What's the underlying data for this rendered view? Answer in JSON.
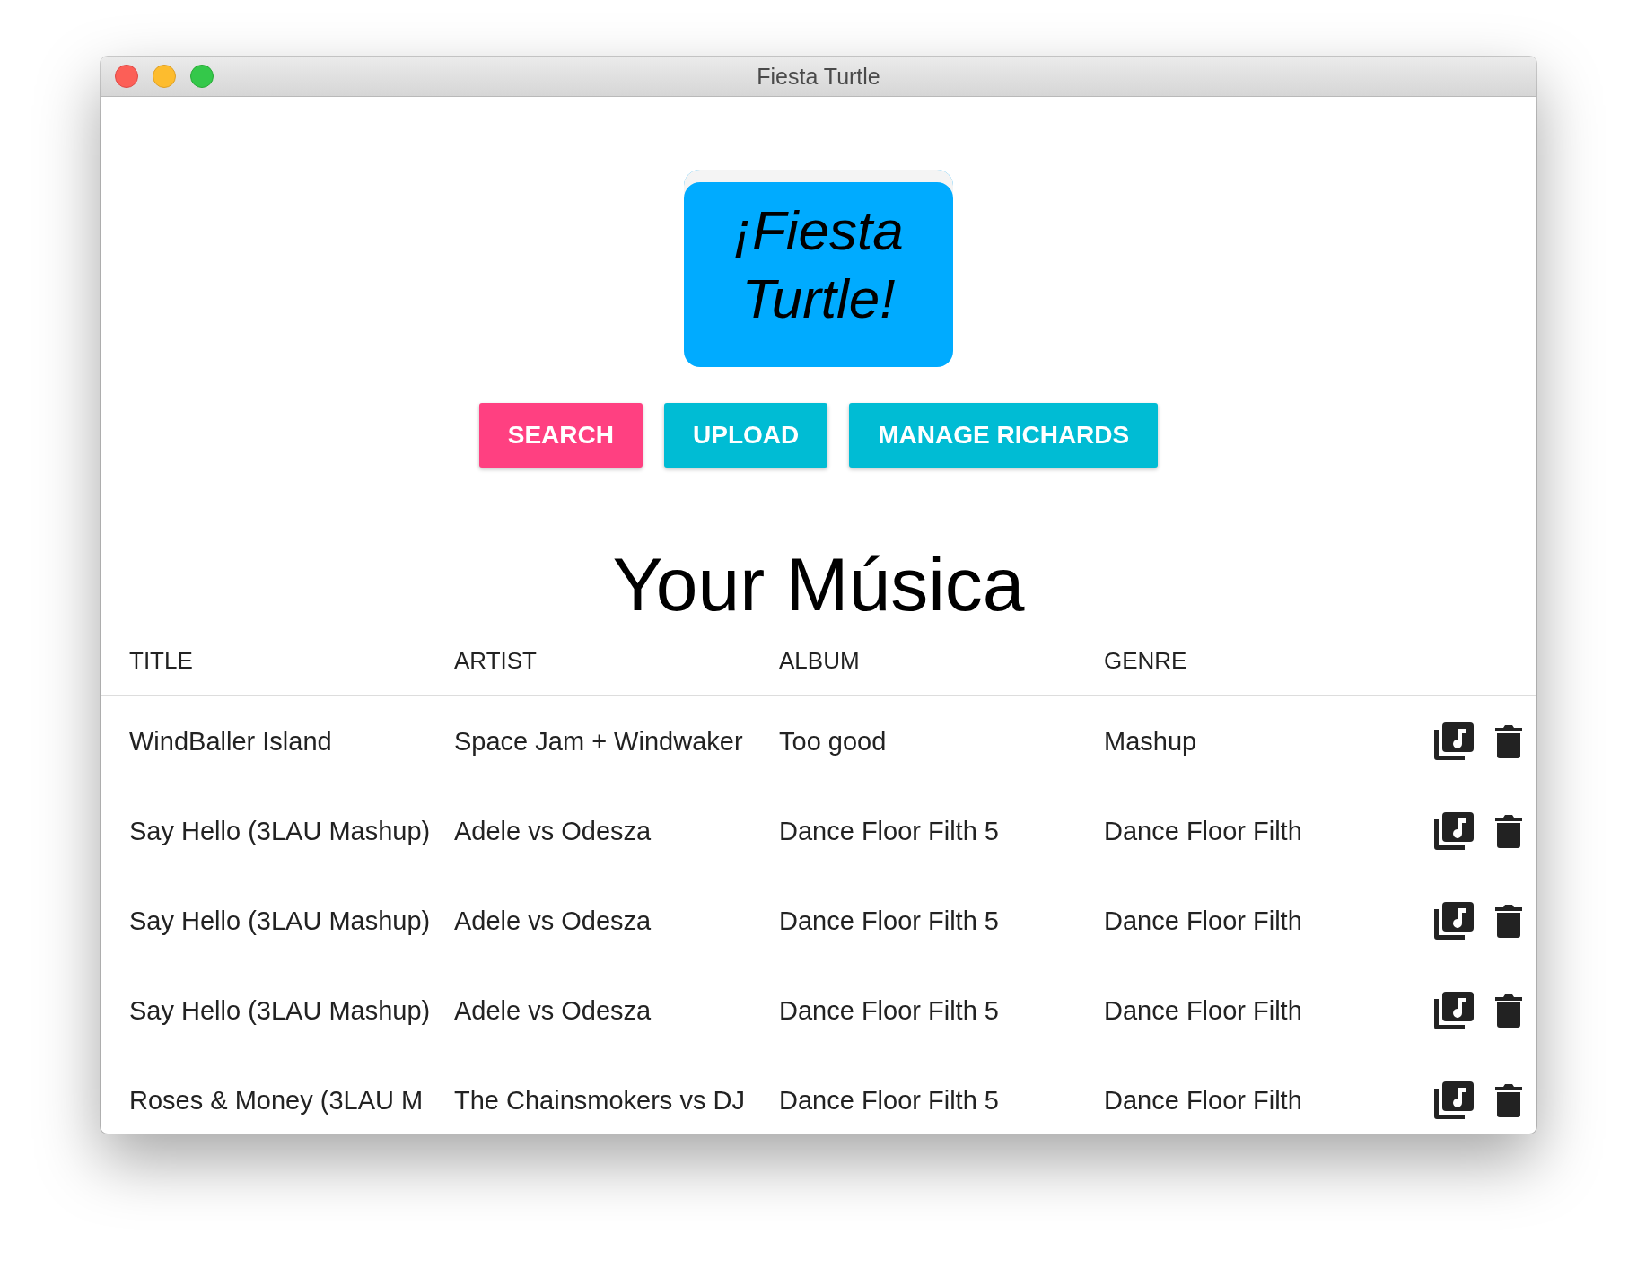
{
  "window": {
    "title": "Fiesta Turtle"
  },
  "logo": {
    "text": "¡Fiesta Turtle!"
  },
  "nav_buttons": [
    {
      "label": "SEARCH",
      "selected": true
    },
    {
      "label": "UPLOAD",
      "selected": false
    },
    {
      "label": "MANAGE RICHARDS",
      "selected": false
    }
  ],
  "heading": "Your Música",
  "table": {
    "columns": [
      "TITLE",
      "ARTIST",
      "ALBUM",
      "GENRE"
    ],
    "rows": [
      [
        "WindBaller Island",
        "Space Jam + Windwaker",
        "Too good",
        "Mashup"
      ],
      [
        "Say Hello (3LAU Mashup)",
        "Adele vs Odesza",
        "Dance Floor Filth 5",
        "Dance Floor Filth"
      ],
      [
        "Say Hello (3LAU Mashup)",
        "Adele vs Odesza",
        "Dance Floor Filth 5",
        "Dance Floor Filth"
      ],
      [
        "Say Hello (3LAU Mashup)",
        "Adele vs Odesza",
        "Dance Floor Filth 5",
        "Dance Floor Filth"
      ],
      [
        "Roses & Money (3LAU M",
        "The Chainsmokers vs DJ",
        "Dance Floor Filth 5",
        "Dance Floor Filth"
      ]
    ]
  }
}
